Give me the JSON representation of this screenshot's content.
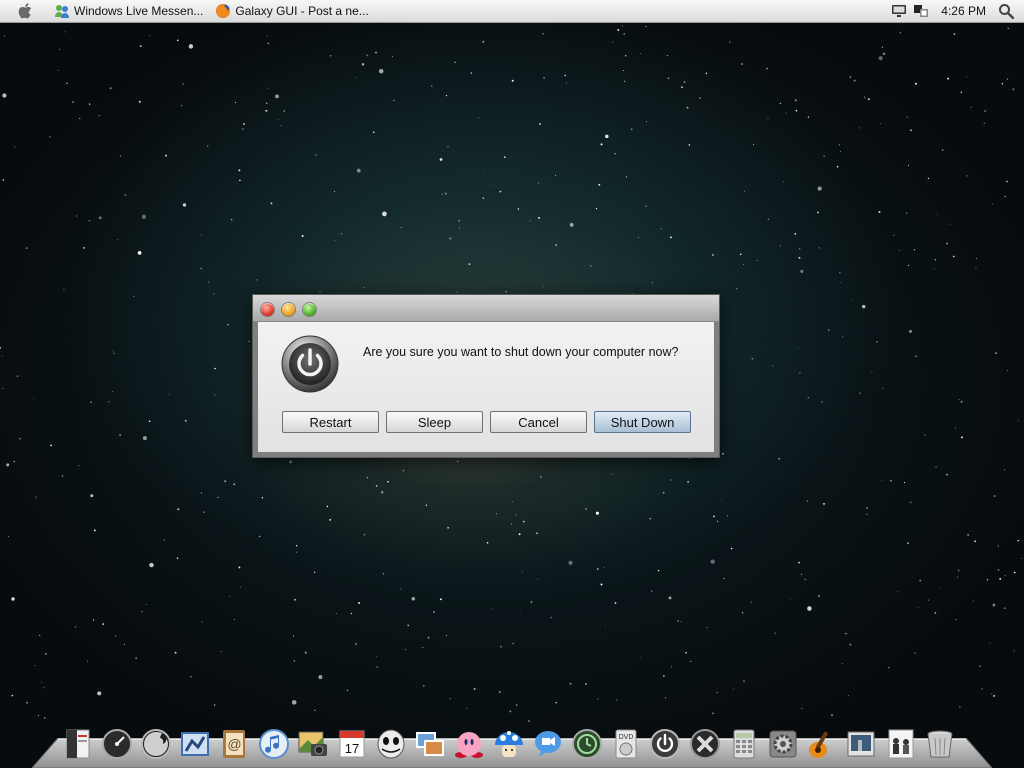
{
  "menubar": {
    "apple_icon": "apple-icon",
    "tasks": [
      {
        "name": "task-windows-live-messenger",
        "label": "Windows Live Messen...",
        "icon": "messenger-icon"
      },
      {
        "name": "task-firefox-galaxy-gui",
        "label": "Galaxy GUI - Post a ne...",
        "icon": "firefox-icon"
      }
    ],
    "tray_icons": [
      "display-icon",
      "network-icon"
    ],
    "clock": "4:26 PM",
    "spotlight_icon": "spotlight-search-icon"
  },
  "dialog": {
    "message": "Are you sure you want to shut down your computer now?",
    "icon": "power-icon",
    "buttons": {
      "restart": "Restart",
      "sleep": "Sleep",
      "cancel": "Cancel",
      "shutdown": "Shut Down"
    },
    "default_button": "shutdown"
  },
  "dock": {
    "items": [
      "pdf-reader-icon",
      "dashboard-icon",
      "firefox-icon",
      "mail-icon",
      "address-book-icon",
      "itunes-icon",
      "iphoto-icon",
      "ical-icon",
      "jack-skellington-icon",
      "preview-icon",
      "kirby-icon",
      "mushroom-icon",
      "ichat-icon",
      "time-machine-icon",
      "dvd-player-icon",
      "power-icon",
      "x-icon",
      "calculator-icon",
      "system-preferences-icon",
      "garageband-icon",
      "photo-booth-icon",
      "people-icon",
      "trash-icon"
    ]
  },
  "colors": {
    "menubar": "#e6e6e6",
    "dialog_default_button": "#a9bfd6",
    "close": "#e0392d",
    "minimize": "#f0a21e",
    "zoom": "#4fb42a"
  }
}
